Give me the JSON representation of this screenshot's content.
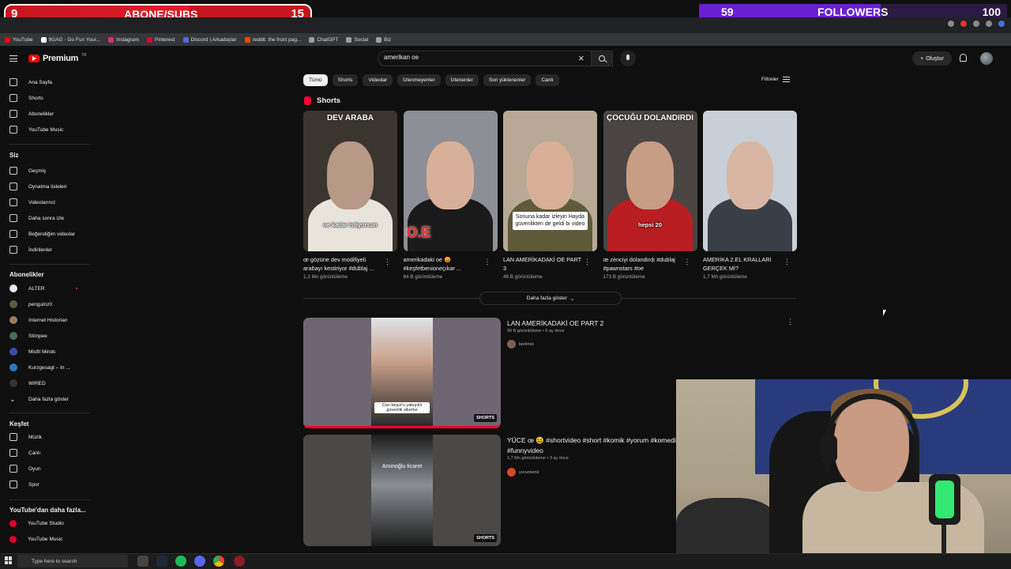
{
  "overlay": {
    "subs": {
      "current": "9",
      "label": "ABONE/SUBS",
      "goal": "15",
      "fraction": 0.6
    },
    "followers": {
      "current": "59",
      "label": "FOLLOWERS",
      "goal": "100",
      "fraction": 0.59
    }
  },
  "bookmarks": [
    {
      "label": "YouTube",
      "color": "#ff0000"
    },
    {
      "label": "9GAG - Go Fun Your...",
      "color": "#ffffff"
    },
    {
      "label": "Instagram",
      "color": "#e1306c"
    },
    {
      "label": "Pinterest",
      "color": "#e60023"
    },
    {
      "label": "Discord | Arkadaşlar",
      "color": "#5865f2"
    },
    {
      "label": "reddit: the front pag...",
      "color": "#ff4500"
    },
    {
      "label": "ChatGPT",
      "color": "#9aa0a6"
    },
    {
      "label": "Social",
      "color": "#9aa0a6"
    },
    {
      "label": "Biz",
      "color": "#9aa0a6"
    }
  ],
  "header": {
    "logo_text": "Premium",
    "logo_region": "TR",
    "search_value": "amerikan oe",
    "create_label": "Oluştur"
  },
  "sidebar": {
    "main": [
      {
        "label": "Ana Sayfa",
        "icon": "home-icon"
      },
      {
        "label": "Shorts",
        "icon": "shorts-icon"
      },
      {
        "label": "Abonelikler",
        "icon": "subscriptions-icon"
      },
      {
        "label": "YouTube Music",
        "icon": "music-icon"
      }
    ],
    "you_heading": "Siz",
    "you": [
      {
        "label": "Geçmiş",
        "icon": "history-icon"
      },
      {
        "label": "Oynatma listeleri",
        "icon": "playlists-icon"
      },
      {
        "label": "Videolarınız",
        "icon": "your-videos-icon"
      },
      {
        "label": "Daha sonra izle",
        "icon": "watch-later-icon"
      },
      {
        "label": "Beğendiğim videolar",
        "icon": "liked-icon"
      },
      {
        "label": "İndirilenler",
        "icon": "downloads-icon"
      }
    ],
    "subs_heading": "Abonelikler",
    "subs": [
      {
        "label": "ALTER",
        "color": "#e8e8e8",
        "live": true
      },
      {
        "label": "penguinz0",
        "color": "#5b5b44",
        "live": false
      },
      {
        "label": "Internet Historian",
        "color": "#9a7a5a",
        "live": false
      },
      {
        "label": "Stimpee",
        "color": "#4a6a5a",
        "live": false
      },
      {
        "label": "Misfit Minds",
        "color": "#3a4ab0",
        "live": false
      },
      {
        "label": "Kurzgesagt – In ...",
        "color": "#2a7ac0",
        "live": false
      },
      {
        "label": "WIRED",
        "color": "#333333",
        "live": false
      },
      {
        "label": "Daha fazla göster",
        "color": "",
        "live": false
      }
    ],
    "explore_heading": "Keşfet",
    "explore": [
      {
        "label": "Müzik",
        "icon": "music-note-icon"
      },
      {
        "label": "Canlı",
        "icon": "live-icon"
      },
      {
        "label": "Oyun",
        "icon": "gaming-icon"
      },
      {
        "label": "Spor",
        "icon": "trophy-icon"
      }
    ],
    "more_heading": "YouTube'dan daha fazla...",
    "more": [
      {
        "label": "YouTube Studio",
        "icon": "studio-icon"
      },
      {
        "label": "YouTube Music",
        "icon": "yt-music-icon"
      }
    ]
  },
  "chips": [
    "Tümü",
    "Shorts",
    "Videolar",
    "İzlenmeyenler",
    "İzlenenler",
    "Son yüklenenler",
    "Canlı"
  ],
  "filters_label": "Filtreler",
  "shorts": {
    "heading": "Shorts",
    "items": [
      {
        "title": "œ gözüne dev modifiyeli arabayı kestiriyor #dublaj ...",
        "views": "1,3 Mn görüntüleme",
        "overlay_top": "DEV ARABA",
        "caption": "ne kadar istiyorsun",
        "bg": "#3b3530",
        "skin": "#b89886",
        "shirt": "#e8e4dc"
      },
      {
        "title": "amerikadaki oe 😡 #keşfetbenioneçıkar ...",
        "views": "84 B görüntüleme",
        "overlay_top": "",
        "caption": "O.E",
        "bg": "#8e8e96",
        "skin": "#d8b09a",
        "shirt": "#1a1a1a"
      },
      {
        "title": "LAN AMERİKADAKİ OE PART 3",
        "views": "48 B görüntüleme",
        "overlay_top": "",
        "caption": "Sonuna kadar izleyin Hayda güvenlikten de geldi bi video",
        "bg": "#b7a995",
        "skin": "#d9b097",
        "shirt": "#5e5a3a"
      },
      {
        "title": "œ zenciyi dolandırdı #dublaj #pawnstars #oe",
        "views": "173 B görüntüleme",
        "overlay_top": "ÇOCUĞU DOLANDIRDI",
        "caption": "hepsi 20",
        "bg": "#4a4542",
        "skin": "#c79d86",
        "shirt": "#b81d22"
      },
      {
        "title": "AMERİKA 2.EL KRALLARI GERÇEK Mİ?",
        "views": "1,7 Mn görüntüleme",
        "overlay_top": "",
        "caption": "",
        "bg": "#c9cfd6",
        "skin": "#d9b6a3",
        "shirt": "#3a3f47"
      }
    ],
    "more_label": "Daha fazla göster"
  },
  "videos": [
    {
      "title": "LAN AMERİKADAKİ OE PART 2",
      "meta": "90 B görüntüleme • 5 ay önce",
      "channel": "berilmis",
      "badge": "SHORTS",
      "caption": "Can beşut'u yakışıklı güvenlik sikeme",
      "bg": "#5f5566",
      "channel_color": "#7a5e55"
    },
    {
      "title": "YÜCE œ 😆 #shortvideo #short #komik #yorum #komedi #funnyvideo",
      "meta": "1,7 Mn görüntüleme • 3 ay önce",
      "channel": "yorumlenk",
      "badge": "SHORTS",
      "caption": "Amınoğlu ticaret",
      "bg": "#3b3a37",
      "channel_color": "#d7472a"
    }
  ],
  "taskbar": {
    "search_placeholder": "Type here to search"
  }
}
